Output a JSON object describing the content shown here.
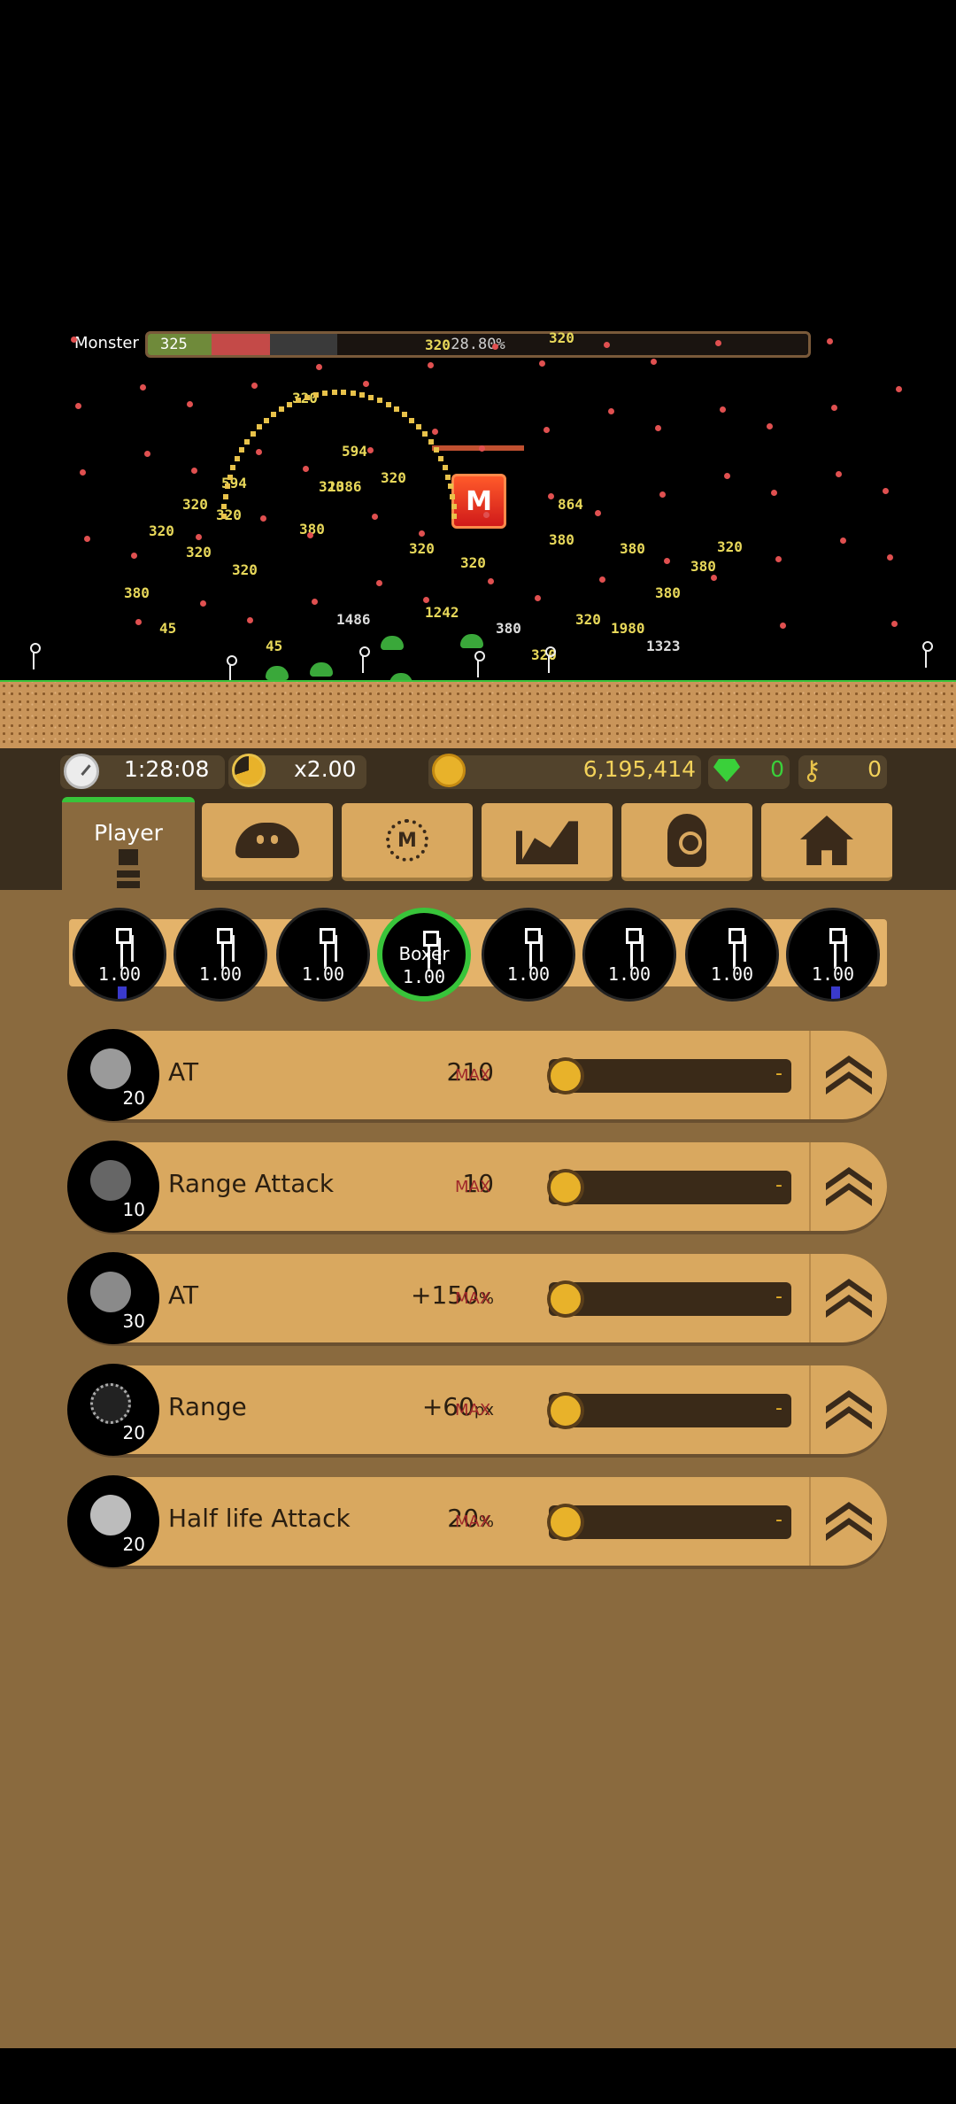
{
  "battle": {
    "monster_label": "Monster",
    "monster_level": "325",
    "monster_progress_text": "28.80%",
    "monster_progress": 0.288,
    "boss_badge": "M"
  },
  "status": {
    "timer": "1:28:08",
    "speed": "x2.00",
    "gold": "6,195,414",
    "gems": "0",
    "keys": "0"
  },
  "tabs": [
    {
      "label": "Player",
      "icon": "player-icon"
    },
    {
      "label": "",
      "icon": "slime-icon"
    },
    {
      "label": "",
      "icon": "monster-m-icon"
    },
    {
      "label": "",
      "icon": "chart-icon"
    },
    {
      "label": "",
      "icon": "medal-icon"
    },
    {
      "label": "",
      "icon": "home-icon"
    }
  ],
  "units": [
    {
      "name": "",
      "level": "1.00"
    },
    {
      "name": "",
      "level": "1.00"
    },
    {
      "name": "",
      "level": "1.00"
    },
    {
      "name": "Boxer",
      "level": "1.00"
    },
    {
      "name": "",
      "level": "1.00"
    },
    {
      "name": "",
      "level": "1.00"
    },
    {
      "name": "",
      "level": "1.00"
    },
    {
      "name": "",
      "level": "1.00"
    }
  ],
  "upgrades": [
    {
      "label": "AT",
      "level": "20",
      "value": "210",
      "unit": "",
      "max": "MAX",
      "cost": "-",
      "icon": "fist-icon"
    },
    {
      "label": "Range Attack",
      "level": "10",
      "value": "10",
      "unit": "",
      "max": "MAX",
      "cost": "-",
      "icon": "shockwave-icon"
    },
    {
      "label": "AT",
      "level": "30",
      "value": "+150",
      "unit": "%",
      "max": "MAX",
      "cost": "-",
      "icon": "knuckles-icon"
    },
    {
      "label": "Range",
      "level": "20",
      "value": "+60",
      "unit": "px",
      "max": "MAX",
      "cost": "-",
      "icon": "range-circle-icon"
    },
    {
      "label": "Half life Attack",
      "level": "20",
      "value": "20",
      "unit": "%",
      "max": "MAX",
      "cost": "-",
      "icon": "broken-heart-icon"
    }
  ]
}
